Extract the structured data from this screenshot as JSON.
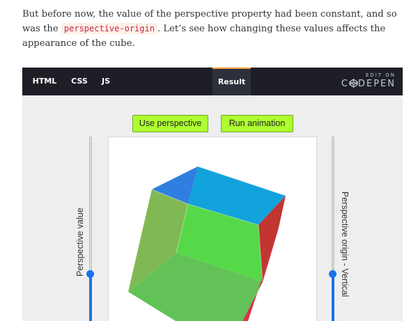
{
  "article": {
    "line1": "But before now, the value of the perspective property had been constant, and so",
    "line2_before": "was the ",
    "line2_code": "perspective-origin",
    "line2_after": ". Let’s see how changing these values affects the",
    "line3": "appearance of the cube."
  },
  "codepen": {
    "tabs": {
      "html": "HTML",
      "css": "CSS",
      "js": "JS",
      "result": "Result"
    },
    "edit_on": "EDIT ON",
    "brand": "DEPEN",
    "colors": {
      "bar": "#1e1f26",
      "active_tab": "#2c303a",
      "active_accent": "#ff9a3d"
    }
  },
  "demo": {
    "use_perspective_label": "Use perspective",
    "run_animation_label": "Run animation",
    "perspective_slider_label": "Perspective value",
    "origin_slider_label": "Perspective origin - Vertical",
    "button_color": "#adff2f",
    "slider_color": "#1a73e8",
    "face_colors": {
      "top": "#12a2dc",
      "top_left": "#2f7ee0",
      "left": "#80b954",
      "front": "#55d948",
      "bottom": "#63c257",
      "right": "#c13631",
      "bottom_right": "#d6364a"
    }
  }
}
